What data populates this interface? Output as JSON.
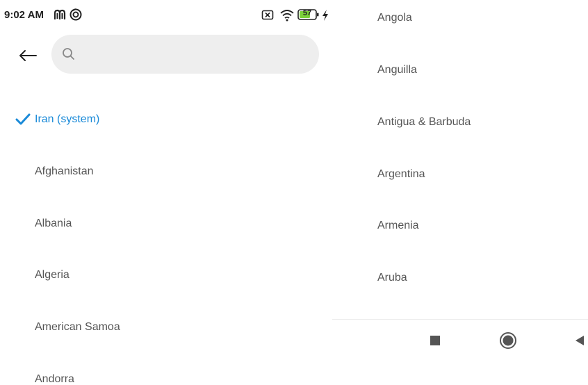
{
  "status_bar": {
    "time": "9:02 AM",
    "battery_level": "57",
    "icons": [
      "m-app-icon",
      "sync-icon",
      "no-sim-icon",
      "wifi-icon",
      "battery-icon",
      "charging-icon"
    ]
  },
  "header": {
    "search_placeholder": "",
    "search_value": ""
  },
  "countries": {
    "selected": "Iran (system)",
    "left_items": [
      "Afghanistan",
      "Albania",
      "Algeria",
      "American Samoa",
      "Andorra"
    ],
    "right_items": [
      "Angola",
      "Anguilla",
      "Antigua & Barbuda",
      "Argentina",
      "Armenia",
      "Aruba"
    ]
  },
  "nav_bar": {
    "buttons": [
      "recents-button",
      "home-button",
      "back-button"
    ]
  },
  "colors": {
    "accent": "#1a8ad8",
    "text": "#555555",
    "search_bg": "#eeeeee",
    "battery_green": "#7bd03a"
  }
}
